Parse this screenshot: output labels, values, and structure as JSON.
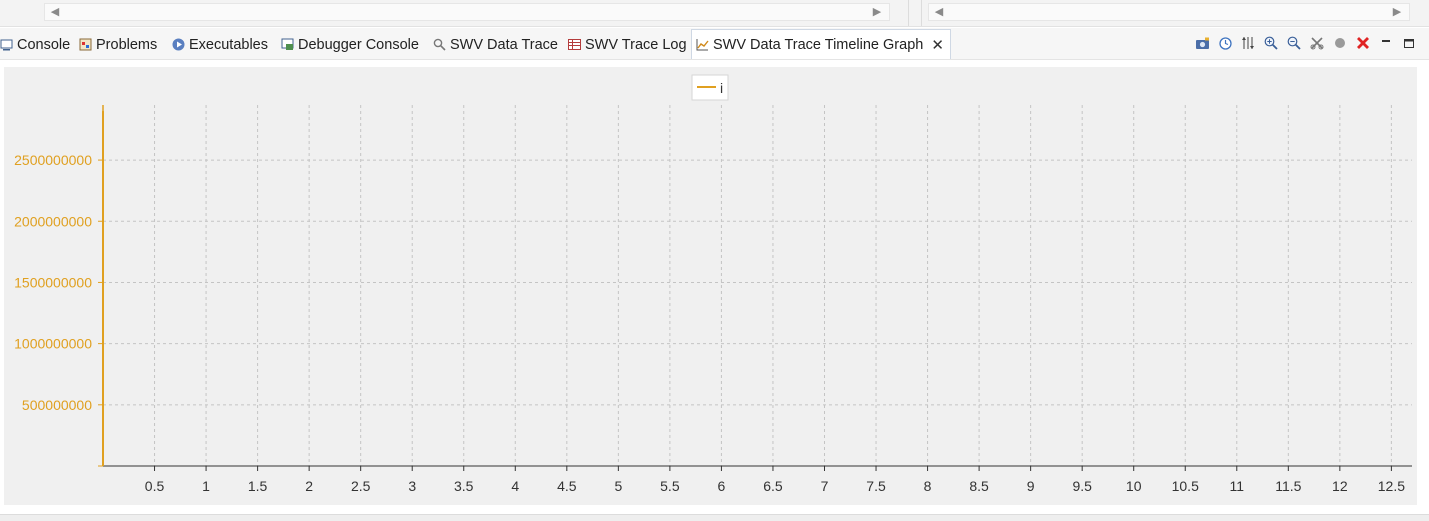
{
  "tabs": [
    {
      "label": "Console",
      "icon": "console-icon",
      "active": false
    },
    {
      "label": "Problems",
      "icon": "problems-icon",
      "active": false
    },
    {
      "label": "Executables",
      "icon": "executables-icon",
      "active": false
    },
    {
      "label": "Debugger Console",
      "icon": "debugger-console-icon",
      "active": false
    },
    {
      "label": "SWV Data Trace",
      "icon": "magnifier-icon",
      "active": false
    },
    {
      "label": "SWV Trace Log",
      "icon": "table-icon",
      "active": false
    },
    {
      "label": "SWV Data Trace Timeline Graph",
      "icon": "line-graph-icon",
      "active": true
    }
  ],
  "toolbar": [
    {
      "icon": "camera-icon"
    },
    {
      "icon": "clock-icon"
    },
    {
      "icon": "adjust-scale-icon"
    },
    {
      "icon": "zoom-in-icon"
    },
    {
      "icon": "zoom-out-icon"
    },
    {
      "icon": "configure-icon"
    },
    {
      "icon": "record-icon"
    },
    {
      "icon": "red-x-icon"
    },
    {
      "icon": "minimize-icon"
    },
    {
      "icon": "maximize-icon"
    }
  ],
  "colors": {
    "series": "#e0a020",
    "axis_label": "#e0a020",
    "grid": "#c4c4c4",
    "plot_bg": "#f0f0f0"
  },
  "chart_data": {
    "type": "line",
    "title": "",
    "xlabel": "",
    "ylabel": "",
    "series": [
      {
        "name": "i",
        "x": [
          0,
          0
        ],
        "y": [
          0,
          2900000000
        ]
      }
    ],
    "xlim": [
      0,
      12.7
    ],
    "ylim": [
      0,
      2950000000
    ],
    "x_ticks": [
      0.5,
      1,
      1.5,
      2,
      2.5,
      3,
      3.5,
      4,
      4.5,
      5,
      5.5,
      6,
      6.5,
      7,
      7.5,
      8,
      8.5,
      9,
      9.5,
      10,
      10.5,
      11,
      11.5,
      12,
      12.5
    ],
    "y_ticks": [
      500000000,
      1000000000,
      1500000000,
      2000000000,
      2500000000
    ],
    "grid": true,
    "legend_position": "top-center"
  }
}
